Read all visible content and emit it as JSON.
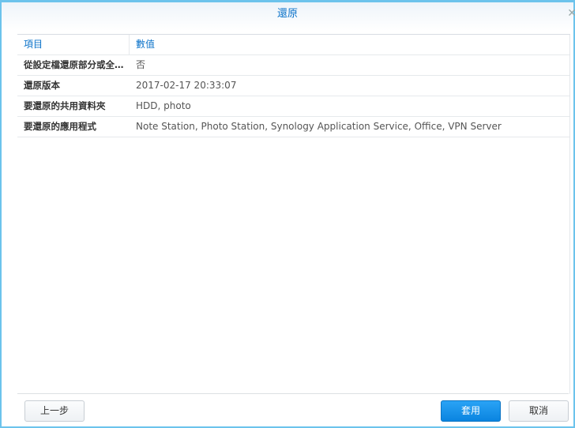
{
  "dialog": {
    "title": "還原",
    "close_icon": "close-icon"
  },
  "table": {
    "headers": [
      "項目",
      "數值"
    ],
    "rows": [
      {
        "item": "從設定檔還原部分或全部設定",
        "value": "否"
      },
      {
        "item": "還原版本",
        "value": "2017-02-17 20:33:07"
      },
      {
        "item": "要還原的共用資料夾",
        "value": "HDD, photo"
      },
      {
        "item": "要還原的應用程式",
        "value": "Note Station, Photo Station, Synology Application Service, Office, VPN Server"
      }
    ]
  },
  "buttons": {
    "back": "上一步",
    "apply": "套用",
    "cancel": "取消"
  }
}
